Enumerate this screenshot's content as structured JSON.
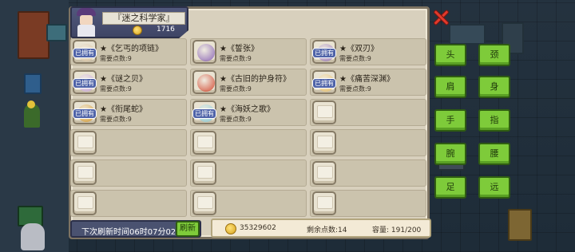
{
  "header": {
    "title": "『迷之科学家』",
    "coins": "1716"
  },
  "owned_tag": "已拥有",
  "items": [
    {
      "name": "★《乞丐的项链》",
      "cost": "需要点数:9",
      "owned": true,
      "relic_color": "#d9c2a0"
    },
    {
      "name": "★《誓张》",
      "cost": "需要点数:9",
      "owned": false,
      "relic_color": "#8a64b4"
    },
    {
      "name": "★《双刃》",
      "cost": "需要点数:9",
      "owned": true,
      "relic_color": "#9a7ab8"
    },
    {
      "name": "★《谜之贝》",
      "cost": "需要点数:9",
      "owned": true,
      "relic_color": "#c8a8d8"
    },
    {
      "name": "★《古旧的护身符》",
      "cost": "需要点数:9",
      "owned": false,
      "relic_color": "#d24a32"
    },
    {
      "name": "★《痛苦深渊》",
      "cost": "需要点数:9",
      "owned": true,
      "relic_color": "#e8c06a"
    },
    {
      "name": "★《衔尾蛇》",
      "cost": "需要点数:9",
      "owned": true,
      "relic_color": "#d69a2e"
    },
    {
      "name": "★《海妖之歌》",
      "cost": "需要点数:9",
      "owned": true,
      "relic_color": "#8acbd6"
    },
    {
      "name": "",
      "cost": "",
      "owned": false,
      "relic_color": ""
    },
    {
      "name": "",
      "cost": "",
      "owned": false,
      "relic_color": ""
    },
    {
      "name": "",
      "cost": "",
      "owned": false,
      "relic_color": ""
    },
    {
      "name": "",
      "cost": "",
      "owned": false,
      "relic_color": ""
    },
    {
      "name": "",
      "cost": "",
      "owned": false,
      "relic_color": ""
    },
    {
      "name": "",
      "cost": "",
      "owned": false,
      "relic_color": ""
    },
    {
      "name": "",
      "cost": "",
      "owned": false,
      "relic_color": ""
    },
    {
      "name": "",
      "cost": "",
      "owned": false,
      "relic_color": ""
    },
    {
      "name": "",
      "cost": "",
      "owned": false,
      "relic_color": ""
    },
    {
      "name": "",
      "cost": "",
      "owned": false,
      "relic_color": ""
    }
  ],
  "footer": {
    "refresh_label": "下次刷新时间06时07分02",
    "refresh_button": "刷新",
    "total_coins": "35329602",
    "remaining_points": "剩余点数:14",
    "capacity": "容量: 191/200"
  },
  "slot_buttons": [
    "头",
    "颈",
    "肩",
    "身",
    "手",
    "指",
    "腕",
    "腰",
    "足",
    "远"
  ],
  "colors": {
    "panel": "#d8d0bd",
    "button_green": "#7ecb3a",
    "close_red": "#e03a2c",
    "owned_tag": "#4f63a8"
  }
}
